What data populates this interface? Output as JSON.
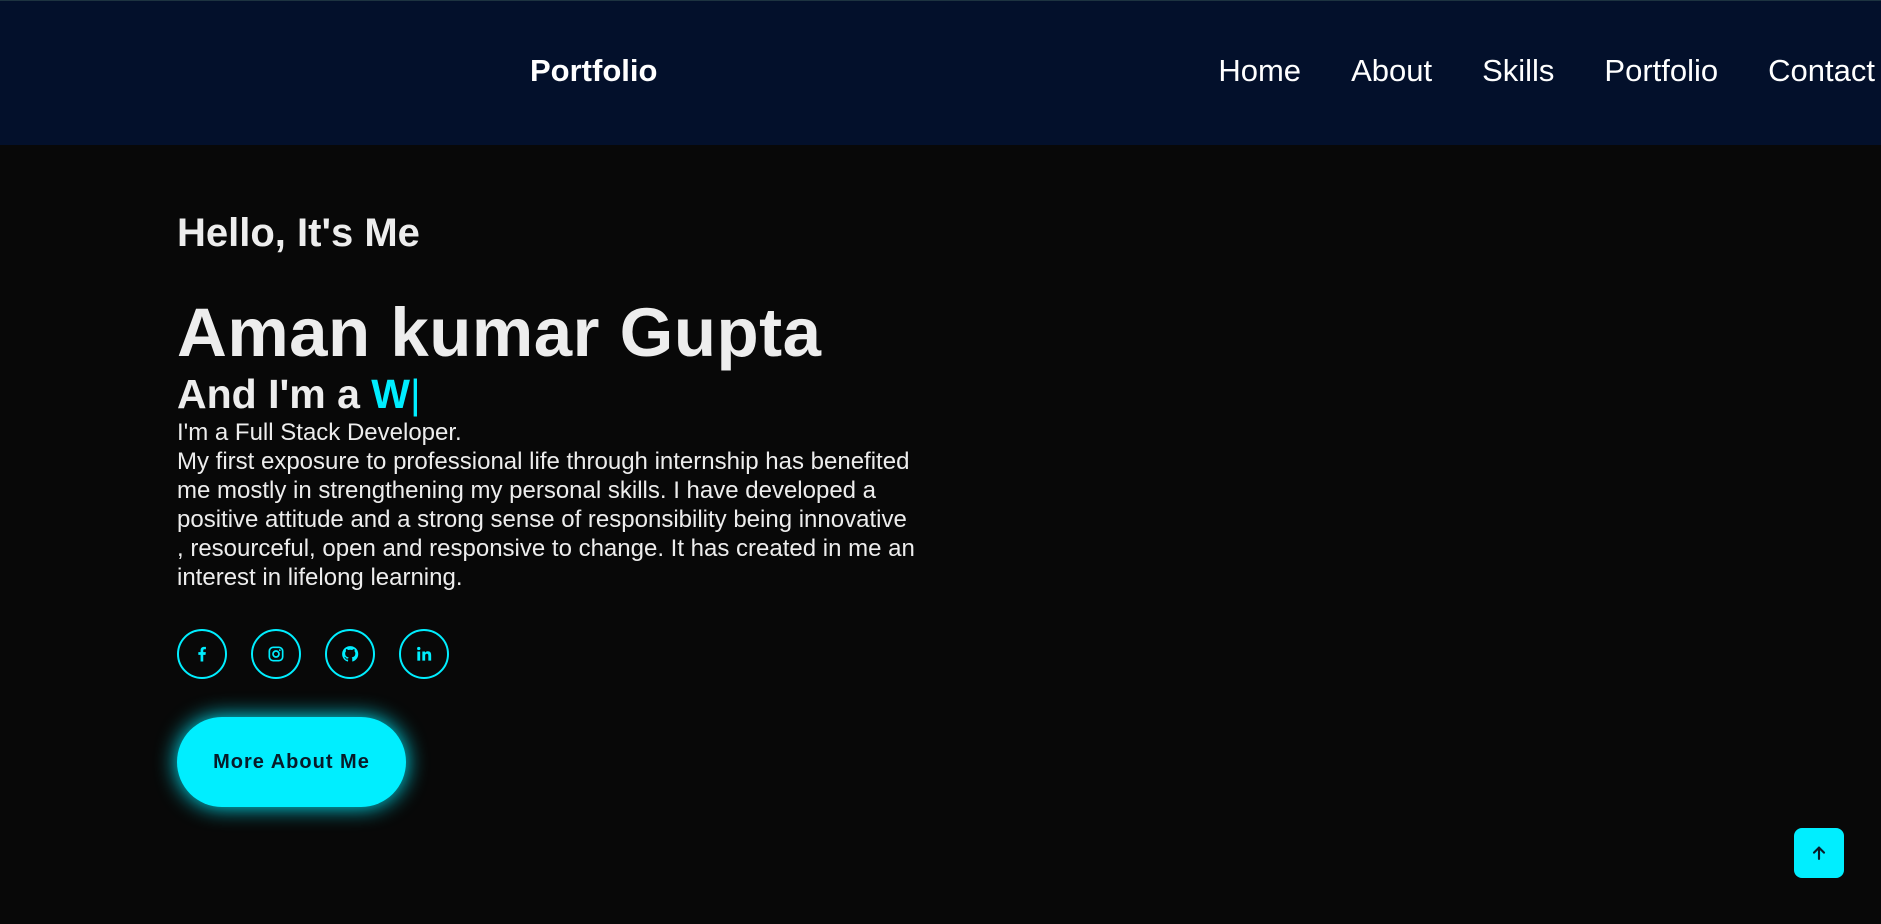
{
  "header": {
    "logo": "Portfolio",
    "nav": [
      {
        "label": "Home"
      },
      {
        "label": "About"
      },
      {
        "label": "Skills"
      },
      {
        "label": "Portfolio"
      },
      {
        "label": "Contact"
      }
    ]
  },
  "hero": {
    "greeting": "Hello, It's Me",
    "name": "Aman kumar Gupta",
    "role_prefix": "And I'm a ",
    "role_typed": "W",
    "cursor": "|",
    "intro_line1": "I'm a Full Stack Developer.",
    "intro_body": "My first exposure to professional life through internship has benefited me mostly in strengthening my personal skills. I have developed a positive attitude and a strong sense of responsibility being innovative , resourceful, open and responsive to change. It has created in me an interest in lifelong learning.",
    "socials": [
      {
        "icon": "facebook-icon"
      },
      {
        "icon": "instagram-icon"
      },
      {
        "icon": "github-icon"
      },
      {
        "icon": "linkedin-icon"
      }
    ],
    "cta_label": "More About Me"
  },
  "scroll_top": {
    "icon": "arrow-up-icon"
  },
  "colors": {
    "accent": "#00eeff",
    "header_bg": "#03102b",
    "page_bg": "#080808",
    "text": "#ededed"
  }
}
